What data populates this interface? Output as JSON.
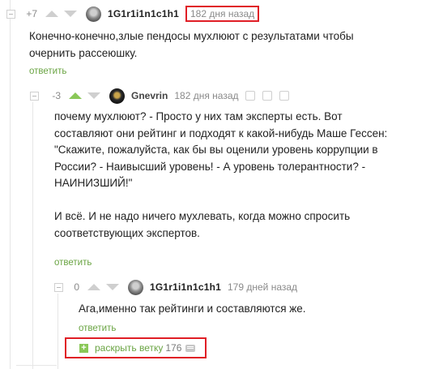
{
  "comments": [
    {
      "rating": "+7",
      "username": "1G1r1i1n1c1h1",
      "time": "182 дня назад",
      "text": [
        "Конечно-конечно,злые пендосы мухлюют с результатами чтобы",
        "очернить рассеюшку."
      ],
      "reply": "ответить"
    },
    {
      "rating": "-3",
      "username": "Gnevrin",
      "time": "182 дня назад",
      "text_lines": [
        "почему мухлюют? - Просто у них там эксперты есть. Вот",
        "составляют они рейтинг и подходят к какой-нибудь Маше Гессен:",
        "\"Скажите, пожалуйста, как бы вы оценили уровень коррупции в",
        "России? - Наивысший уровень! - А уровень толерантности? -",
        "НАИНИЗШИЙ!\"",
        "",
        "И всё. И не надо ничего мухлевать, когда можно спросить",
        "соответствующих экспертов."
      ],
      "reply": "ответить"
    },
    {
      "rating": "0",
      "username": "1G1r1i1n1c1h1",
      "time": "179 дней назад",
      "text": [
        "Ага,именно так рейтинги и составляются же."
      ],
      "reply": "ответить"
    }
  ],
  "expand": {
    "plus": "+",
    "label": "раскрыть ветку",
    "count": "176"
  },
  "colors": {
    "accent_green": "#8ac858",
    "link_green": "#6aa443",
    "highlight_red": "#e01e26"
  }
}
